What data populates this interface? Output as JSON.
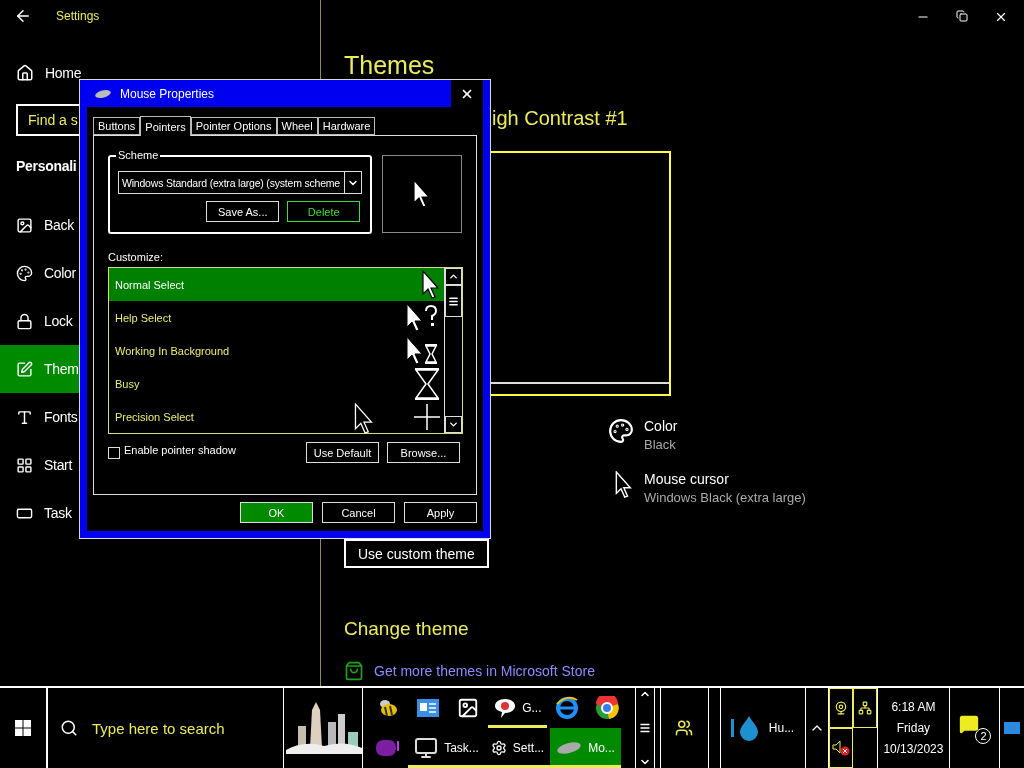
{
  "settings_window": {
    "title": "Settings"
  },
  "nav": {
    "home": "Home",
    "search": {
      "placeholder": "Find a s"
    },
    "section": "Personali",
    "items": [
      {
        "kind": "background",
        "label": "Back",
        "selected": false
      },
      {
        "kind": "colors",
        "label": "Color",
        "selected": false
      },
      {
        "kind": "lock",
        "label": "Lock",
        "selected": false
      },
      {
        "kind": "themes",
        "label": "Them",
        "selected": true
      },
      {
        "kind": "fonts",
        "label": "Fonts",
        "selected": false
      },
      {
        "kind": "start",
        "label": "Start",
        "selected": false
      },
      {
        "kind": "taskbar",
        "label": "Task",
        "selected": false
      }
    ]
  },
  "content": {
    "heading": "Themes",
    "current_theme": "igh Contrast #1",
    "settings": [
      {
        "kind": "color",
        "label": "Color",
        "value": "Black"
      },
      {
        "kind": "cursor",
        "label": "Mouse cursor",
        "value": "Windows Black (extra large)"
      }
    ],
    "custom_button": "Use custom theme",
    "change_heading": "Change theme",
    "store_link": "Get more themes in Microsoft Store"
  },
  "dialog": {
    "title": "Mouse Properties",
    "tabs": [
      {
        "label": "Buttons",
        "selected": false
      },
      {
        "label": "Pointers",
        "selected": true
      },
      {
        "label": "Pointer Options",
        "selected": false
      },
      {
        "label": "Wheel",
        "selected": false
      },
      {
        "label": "Hardware",
        "selected": false
      }
    ],
    "scheme_label": "Scheme",
    "scheme_value": "Windows Standard (extra large) (system scheme",
    "scheme_buttons": [
      {
        "label": "Save As...",
        "kind": "normal"
      },
      {
        "label": "Delete",
        "kind": "accent"
      }
    ],
    "customize_label": "Customize:",
    "pointers": [
      {
        "kind": "arrow",
        "label": "Normal Select",
        "selected": true
      },
      {
        "kind": "help",
        "label": "Help Select",
        "selected": false
      },
      {
        "kind": "working",
        "label": "Working In Background",
        "selected": false
      },
      {
        "kind": "busy",
        "label": "Busy",
        "selected": false
      },
      {
        "kind": "cross",
        "label": "Precision Select",
        "selected": false
      }
    ],
    "shadow": {
      "label": "Enable pointer shadow",
      "checked": false
    },
    "list_buttons": [
      "Use Default",
      "Browse..."
    ],
    "footer_buttons": [
      {
        "label": "OK",
        "default": true
      },
      {
        "label": "Cancel",
        "default": false
      },
      {
        "label": "Apply",
        "default": false
      }
    ]
  },
  "taskbar": {
    "search_placeholder": "Type here to search",
    "apps_top": [
      {
        "kind": "bee",
        "running": false,
        "selected": false
      },
      {
        "kind": "news",
        "running": false,
        "selected": false
      },
      {
        "kind": "photos",
        "running": false,
        "selected": false
      },
      {
        "kind": "talk",
        "label": "G...",
        "running": true,
        "selected": false
      },
      {
        "kind": "ie",
        "running": false,
        "selected": false
      },
      {
        "kind": "globe",
        "running": false,
        "selected": false
      }
    ],
    "apps_bottom": [
      {
        "kind": "yahoo",
        "running": false,
        "selected": false
      },
      {
        "kind": "monitor",
        "label": "Task...",
        "running": true,
        "selected": false
      },
      {
        "kind": "gear",
        "label": "Sett...",
        "running": true,
        "selected": false
      },
      {
        "kind": "mouse",
        "label": "Mo...",
        "running": true,
        "selected": true
      }
    ],
    "weather": "Hu...",
    "time": "6:18 AM",
    "day": "Friday",
    "date": "10/13/2023",
    "notifications": "2"
  }
}
